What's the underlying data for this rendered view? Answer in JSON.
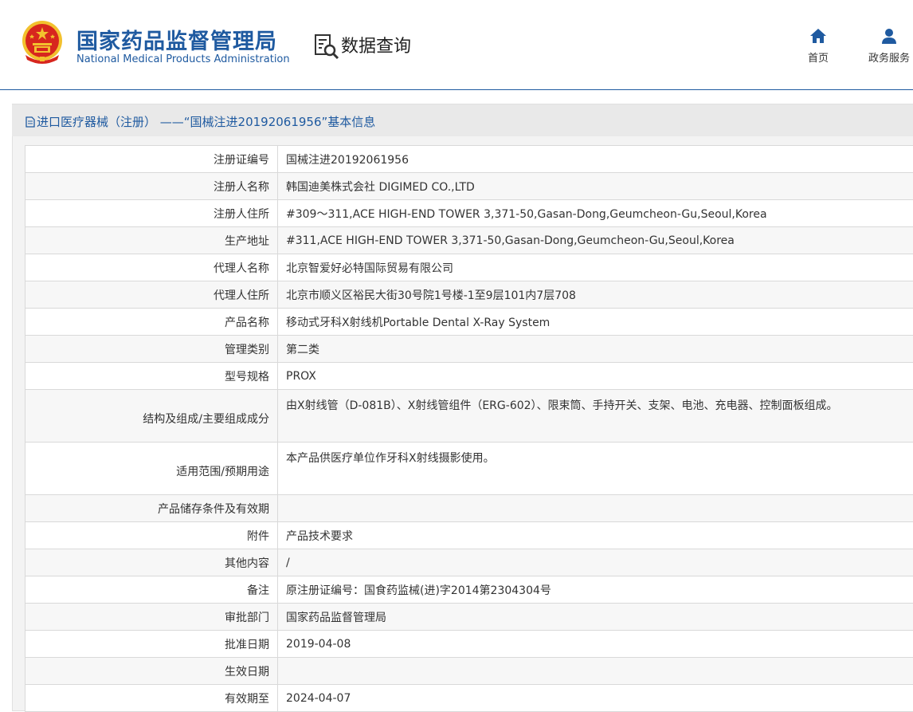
{
  "header": {
    "brand_cn": "国家药品监督管理局",
    "brand_en": "National Medical Products Administration",
    "search_label": "数据查询",
    "nav": [
      {
        "label": "首页",
        "icon": "home-icon"
      },
      {
        "label": "政务服务",
        "icon": "user-icon"
      }
    ],
    "colors": {
      "brand": "#1f5aa0",
      "emblem_red": "#d7261e",
      "emblem_gold": "#f2c12e"
    }
  },
  "panel": {
    "title": "进口医疗器械（注册） ——“国械注进20192061956”基本信息",
    "icon": "document-icon"
  },
  "rows": [
    {
      "key": "注册证编号",
      "value": "国械注进20192061956"
    },
    {
      "key": "注册人名称",
      "value": "韩国迪美株式会社 DIGIMED CO.,LTD"
    },
    {
      "key": "注册人住所",
      "value": "#309～311,ACE HIGH-END TOWER 3,371-50,Gasan-Dong,Geumcheon-Gu,Seoul,Korea"
    },
    {
      "key": "生产地址",
      "value": "#311,ACE HIGH-END TOWER 3,371-50,Gasan-Dong,Geumcheon-Gu,Seoul,Korea"
    },
    {
      "key": "代理人名称",
      "value": "北京智爱好必特国际贸易有限公司"
    },
    {
      "key": "代理人住所",
      "value": "北京市顺义区裕民大街30号院1号楼-1至9层101内7层708"
    },
    {
      "key": "产品名称",
      "value": "移动式牙科X射线机Portable Dental X-Ray System"
    },
    {
      "key": "管理类别",
      "value": "第二类"
    },
    {
      "key": "型号规格",
      "value": "PROX"
    },
    {
      "key": "结构及组成/主要组成成分",
      "value": "由X射线管（D-081B）、X射线管组件（ERG-602）、限束筒、手持开关、支架、电池、充电器、控制面板组成。"
    },
    {
      "key": "适用范围/预期用途",
      "value": "本产品供医疗单位作牙科X射线摄影使用。"
    },
    {
      "key": "产品储存条件及有效期",
      "value": ""
    },
    {
      "key": "附件",
      "value": "产品技术要求"
    },
    {
      "key": "其他内容",
      "value": "/"
    },
    {
      "key": "备注",
      "value": "原注册证编号：国食药监械(进)字2014第2304304号"
    },
    {
      "key": "审批部门",
      "value": "国家药品监督管理局"
    },
    {
      "key": "批准日期",
      "value": "2019-04-08"
    },
    {
      "key": "生效日期",
      "value": ""
    },
    {
      "key": "有效期至",
      "value": "2024-04-07"
    }
  ]
}
